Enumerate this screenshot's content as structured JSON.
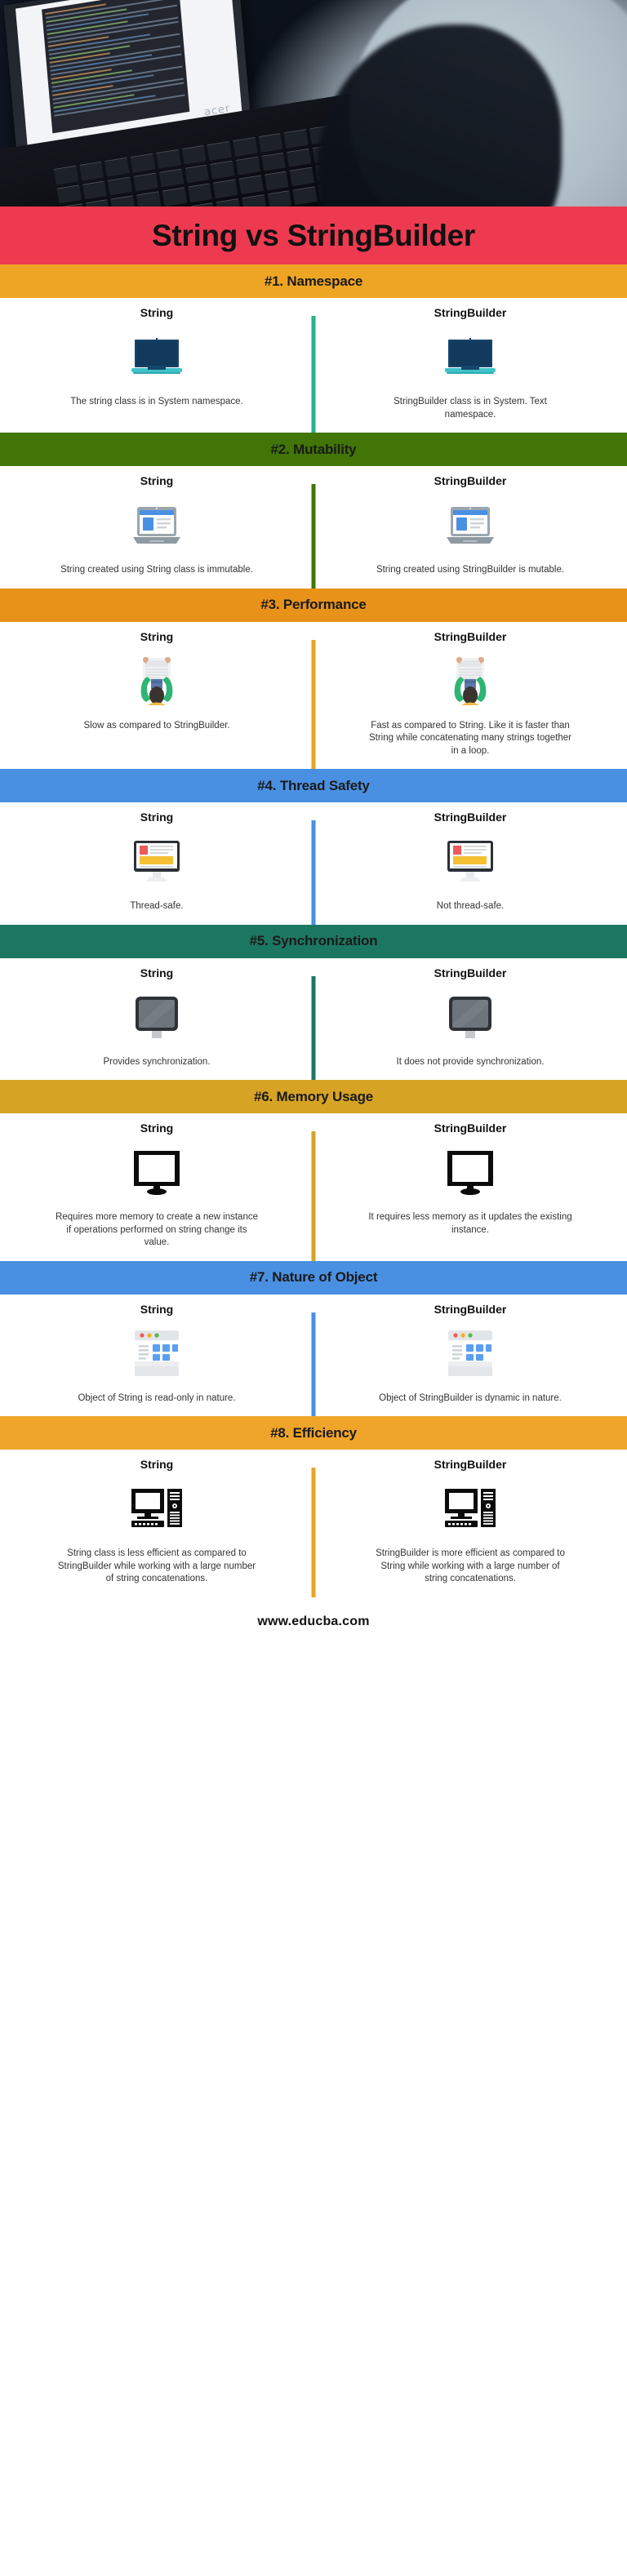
{
  "brand": {
    "hero_laptop_brand": "acer",
    "footer_url": "www.educba.com"
  },
  "title": {
    "heading": "String vs StringBuilder",
    "band_color": "#ed3a50",
    "text_color": "#111111"
  },
  "columns": {
    "left_label": "String",
    "right_label": "StringBuilder"
  },
  "sections": [
    {
      "heading": "#1. Namespace",
      "bar_color": "#efa524",
      "divider_color": "#27b48a",
      "icon": "monitor-dark-blue-icon",
      "left": {
        "label": "String",
        "desc": "The string class is in System namespace."
      },
      "right": {
        "label": "StringBuilder",
        "desc": "StringBuilder class is in System. Text namespace."
      }
    },
    {
      "heading": "#2. Mutability",
      "bar_color": "#417505",
      "divider_color": "#417505",
      "icon": "laptop-webpage-icon",
      "left": {
        "label": "String",
        "desc": "String created using String class is immutable."
      },
      "right": {
        "label": "StringBuilder",
        "desc": "String created using StringBuilder is mutable."
      }
    },
    {
      "heading": "#3. Performance",
      "bar_color": "#e8921a",
      "divider_color": "#e8a424",
      "icon": "person-typing-icon",
      "left": {
        "label": "String",
        "desc": "Slow as compared to StringBuilder."
      },
      "right": {
        "label": "StringBuilder",
        "desc": "Fast as compared to String. Like it is faster than String while concatenating many strings together in a loop."
      }
    },
    {
      "heading": "#4. Thread Safety",
      "bar_color": "#4a90e2",
      "divider_color": "#4a90e2",
      "icon": "desktop-monitor-content-icon",
      "left": {
        "label": "String",
        "desc": "Thread-safe."
      },
      "right": {
        "label": "StringBuilder",
        "desc": "Not thread-safe."
      }
    },
    {
      "heading": "#5. Synchronization",
      "bar_color": "#1c7761",
      "divider_color": "#1c7761",
      "icon": "gray-monitor-icon",
      "left": {
        "label": "String",
        "desc": "Provides synchronization."
      },
      "right": {
        "label": "StringBuilder",
        "desc": "It does not provide synchronization."
      }
    },
    {
      "heading": "#6. Memory Usage",
      "bar_color": "#d6a324",
      "divider_color": "#d6a324",
      "icon": "black-monitor-outline-icon",
      "left": {
        "label": "String",
        "desc": "Requires more memory to create a new instance if operations performed on string change its value."
      },
      "right": {
        "label": "StringBuilder",
        "desc": "It requires less memory as it updates the existing instance."
      }
    },
    {
      "heading": "#7. Nature of Object",
      "bar_color": "#4a90e2",
      "divider_color": "#4a90e2",
      "icon": "browser-window-icon",
      "left": {
        "label": "String",
        "desc": "Object of String is read-only in nature."
      },
      "right": {
        "label": "StringBuilder",
        "desc": "Object of StringBuilder is dynamic in nature."
      }
    },
    {
      "heading": "#8. Efficiency",
      "bar_color": "#efa52a",
      "divider_color": "#e8a424",
      "icon": "desktop-computer-tower-icon",
      "left": {
        "label": "String",
        "desc": "String class is less efficient as compared to StringBuilder while working with a large number of string concatenations."
      },
      "right": {
        "label": "StringBuilder",
        "desc": "StringBuilder is more efficient as compared to String while working with a large number of string concatenations."
      }
    }
  ]
}
